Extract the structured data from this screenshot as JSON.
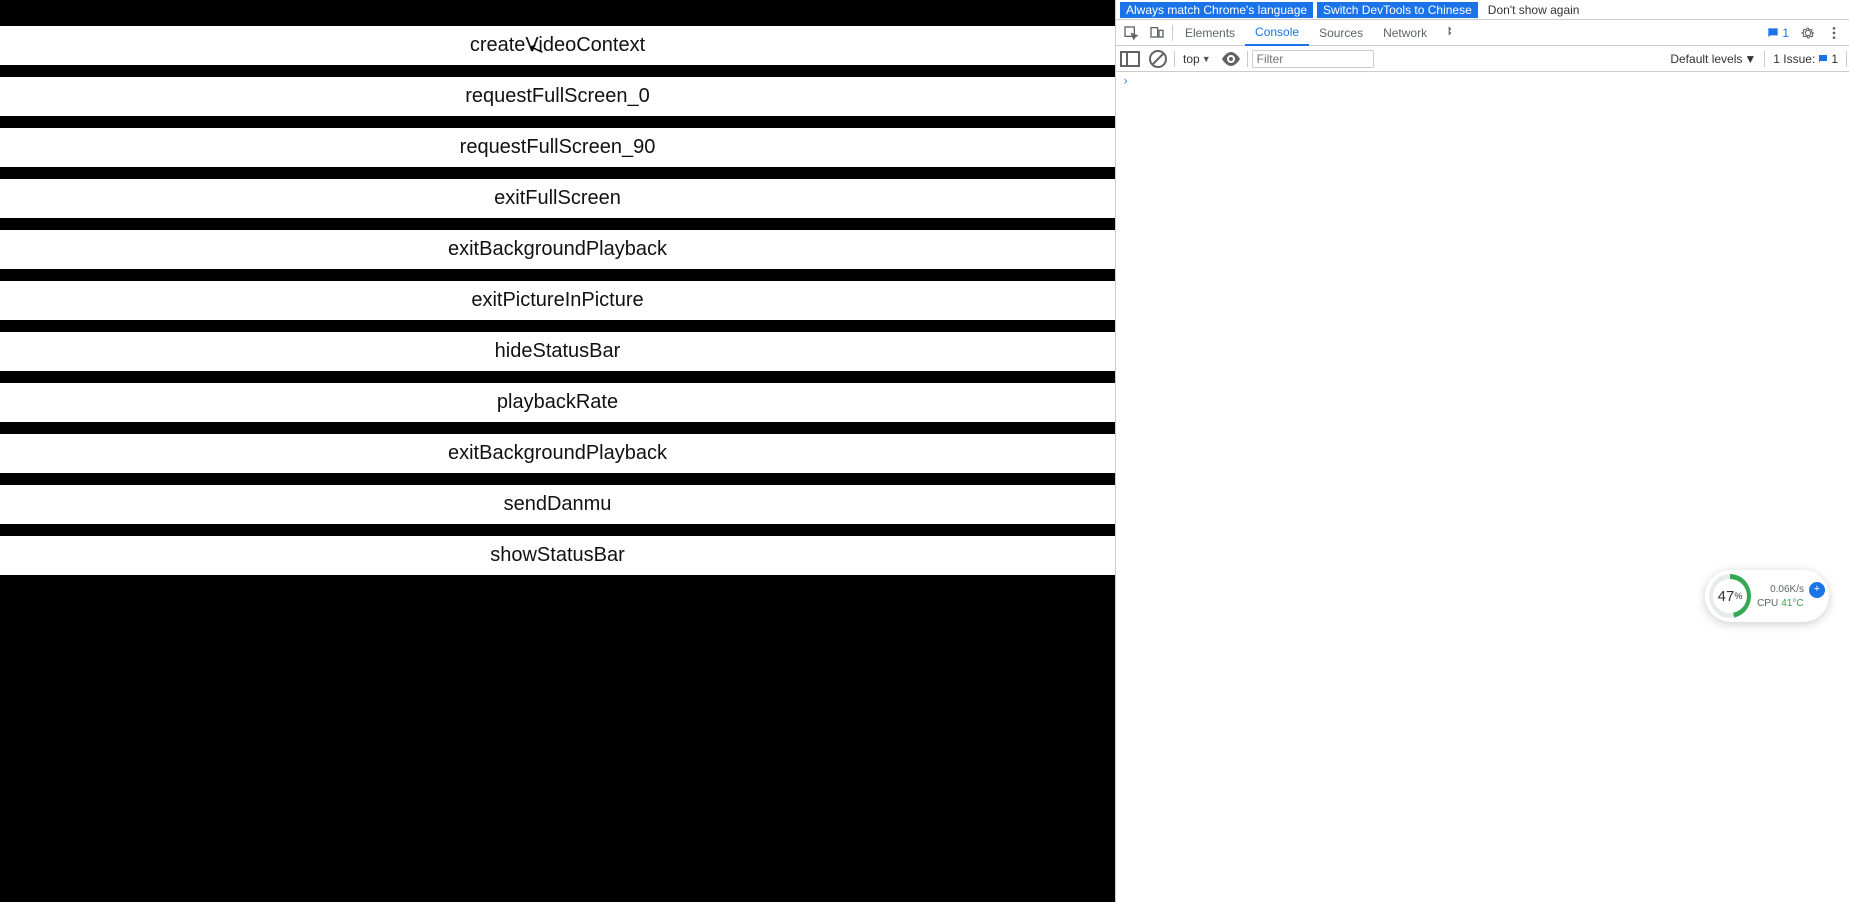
{
  "buttons": [
    {
      "label": "createVideoContext"
    },
    {
      "label": "requestFullScreen_0"
    },
    {
      "label": "requestFullScreen_90"
    },
    {
      "label": "exitFullScreen"
    },
    {
      "label": "exitBackgroundPlayback"
    },
    {
      "label": "exitPictureInPicture"
    },
    {
      "label": "hideStatusBar"
    },
    {
      "label": "playbackRate"
    },
    {
      "label": "exitBackgroundPlayback"
    },
    {
      "label": "sendDanmu"
    },
    {
      "label": "showStatusBar"
    }
  ],
  "infobar": {
    "match": "Always match Chrome's language",
    "switch": "Switch DevTools to Chinese",
    "dont": "Don't show again"
  },
  "tabs": {
    "elements": "Elements",
    "console": "Console",
    "sources": "Sources",
    "network": "Network",
    "msg_count": "1"
  },
  "toolbar": {
    "context": "top",
    "filter_placeholder": "Filter",
    "levels": "Default levels",
    "issue_label": "1 Issue:",
    "issue_count": "1"
  },
  "syswidget": {
    "pct": "47",
    "pct_sym": "%",
    "net": "0.06K/s",
    "cpu_label": "CPU",
    "cpu_temp": "41°C"
  }
}
